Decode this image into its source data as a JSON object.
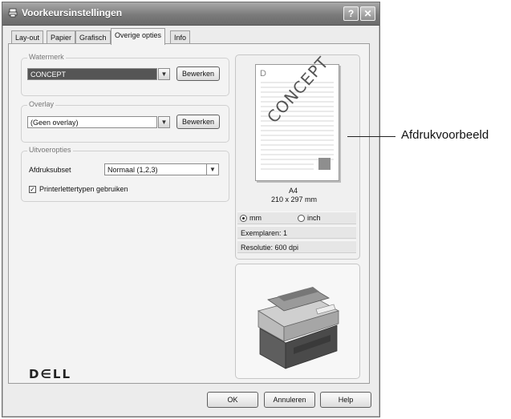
{
  "window": {
    "title": "Voorkeursinstellingen",
    "help_glyph": "?",
    "close_glyph": "✕"
  },
  "tabs": [
    {
      "label": "Lay-out"
    },
    {
      "label": "Papier"
    },
    {
      "label": "Grafisch"
    },
    {
      "label": "Overige opties",
      "active": true
    },
    {
      "label": "Info"
    }
  ],
  "watermark": {
    "group_label": "Watermerk",
    "selected": "CONCEPT",
    "edit_label": "Bewerken"
  },
  "overlay": {
    "group_label": "Overlay",
    "selected": "(Geen overlay)",
    "edit_label": "Bewerken"
  },
  "output": {
    "group_label": "Uitvoeropties",
    "subset_label": "Afdruksubset",
    "subset_value": "Normaal (1,2,3)",
    "printer_fonts_label": "Printerlettertypen gebruiken",
    "printer_fonts_checked": true
  },
  "preview": {
    "page_letter": "D",
    "watermark_text": "CONCEPT",
    "paper_name": "A4",
    "paper_size": "210 x 297 mm",
    "unit_mm": "mm",
    "unit_inch": "inch",
    "selected_unit": "mm",
    "copies": "Exemplaren: 1",
    "resolution": "Resolutie: 600 dpi"
  },
  "brand": {
    "logo_text": "D∈LL"
  },
  "buttons": {
    "ok": "OK",
    "cancel": "Annuleren",
    "help": "Help"
  },
  "callout": {
    "label": "Afdrukvoorbeeld"
  },
  "colors": {
    "titlebar": "#7b7b7b",
    "accent_gray": "#808080"
  }
}
